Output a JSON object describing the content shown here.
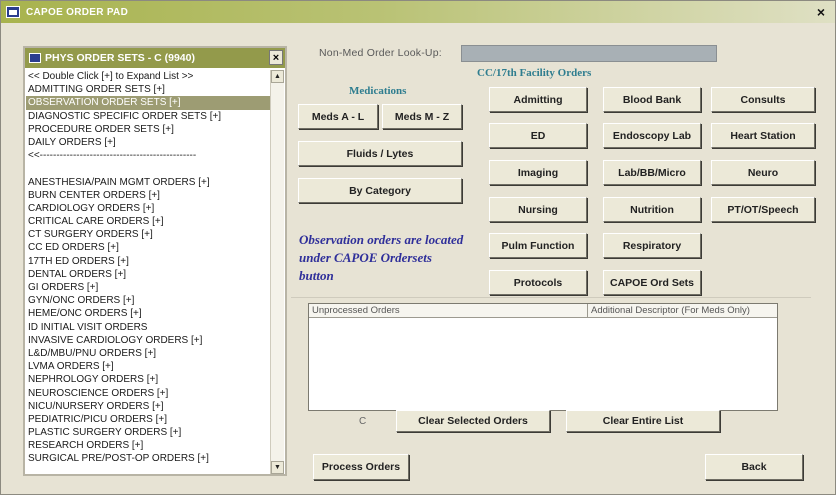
{
  "window": {
    "title": "CAPOE ORDER PAD",
    "close_label": "×"
  },
  "left_panel": {
    "title": "PHYS ORDER SETS - C (9940)",
    "close_label": "×",
    "items": [
      {
        "label": "<< Double Click [+] to Expand List >>",
        "selected": false
      },
      {
        "label": "ADMITTING ORDER SETS [+]",
        "selected": false
      },
      {
        "label": "OBSERVATION ORDER SETS [+]",
        "selected": true
      },
      {
        "label": "DIAGNOSTIC SPECIFIC ORDER SETS [+]",
        "selected": false
      },
      {
        "label": "PROCEDURE ORDER SETS [+]",
        "selected": false
      },
      {
        "label": "DAILY ORDERS [+]",
        "selected": false
      },
      {
        "label": "<<-----------------------------------------------",
        "selected": false
      },
      {
        "label": "",
        "selected": false
      },
      {
        "label": "ANESTHESIA/PAIN MGMT ORDERS [+]",
        "selected": false
      },
      {
        "label": "BURN CENTER ORDERS [+]",
        "selected": false
      },
      {
        "label": "CARDIOLOGY ORDERS [+]",
        "selected": false
      },
      {
        "label": "CRITICAL CARE ORDERS [+]",
        "selected": false
      },
      {
        "label": "CT SURGERY ORDERS [+]",
        "selected": false
      },
      {
        "label": "CC ED ORDERS [+]",
        "selected": false
      },
      {
        "label": "17TH ED ORDERS [+]",
        "selected": false
      },
      {
        "label": "DENTAL ORDERS [+]",
        "selected": false
      },
      {
        "label": "GI ORDERS [+]",
        "selected": false
      },
      {
        "label": "GYN/ONC ORDERS [+]",
        "selected": false
      },
      {
        "label": "HEME/ONC ORDERS [+]",
        "selected": false
      },
      {
        "label": "ID INITIAL VISIT ORDERS",
        "selected": false
      },
      {
        "label": "INVASIVE CARDIOLOGY ORDERS [+]",
        "selected": false
      },
      {
        "label": "L&D/MBU/PNU ORDERS [+]",
        "selected": false
      },
      {
        "label": "LVMA ORDERS [+]",
        "selected": false
      },
      {
        "label": "NEPHROLOGY ORDERS [+]",
        "selected": false
      },
      {
        "label": "NEUROSCIENCE ORDERS [+]",
        "selected": false
      },
      {
        "label": "NICU/NURSERY ORDERS [+]",
        "selected": false
      },
      {
        "label": "PEDIATRIC/PICU ORDERS [+]",
        "selected": false
      },
      {
        "label": "PLASTIC SURGERY ORDERS [+]",
        "selected": false
      },
      {
        "label": "RESEARCH ORDERS [+]",
        "selected": false
      },
      {
        "label": "SURGICAL PRE/POST-OP ORDERS [+]",
        "selected": false
      }
    ]
  },
  "lookup": {
    "label": "Non-Med Order Look-Up:",
    "value": ""
  },
  "facility_heading": "CC/17th Facility Orders",
  "medications": {
    "heading": "Medications",
    "buttons": {
      "meds_a_l": "Meds A - L",
      "meds_m_z": "Meds M - Z",
      "fluids": "Fluids / Lytes",
      "by_category": "By Category"
    }
  },
  "order_buttons": {
    "admitting": "Admitting",
    "blood_bank": "Blood Bank",
    "consults": "Consults",
    "ed": "ED",
    "endoscopy": "Endoscopy Lab",
    "heart_station": "Heart Station",
    "imaging": "Imaging",
    "lab": "Lab/BB/Micro",
    "neuro": "Neuro",
    "nursing": "Nursing",
    "nutrition": "Nutrition",
    "pt_ot": "PT/OT/Speech",
    "pulm": "Pulm Function",
    "respiratory": "Respiratory",
    "protocols": "Protocols",
    "capoe_sets": "CAPOE Ord Sets"
  },
  "note": "Observation orders are located under CAPOE Ordersets button",
  "orders_table": {
    "col1": "Unprocessed Orders",
    "col2": "Additional Descriptor (For Meds Only)"
  },
  "clear_indicator": "C",
  "actions": {
    "clear_selected": "Clear Selected Orders",
    "clear_entire": "Clear Entire List",
    "process": "Process Orders",
    "back": "Back"
  },
  "colors": {
    "title_bar": "#a8b34e",
    "panel_title": "#939a4b",
    "selected_row": "#9d9c73",
    "note_text": "#2f2f9a",
    "heading_text": "#2e7d8f"
  }
}
